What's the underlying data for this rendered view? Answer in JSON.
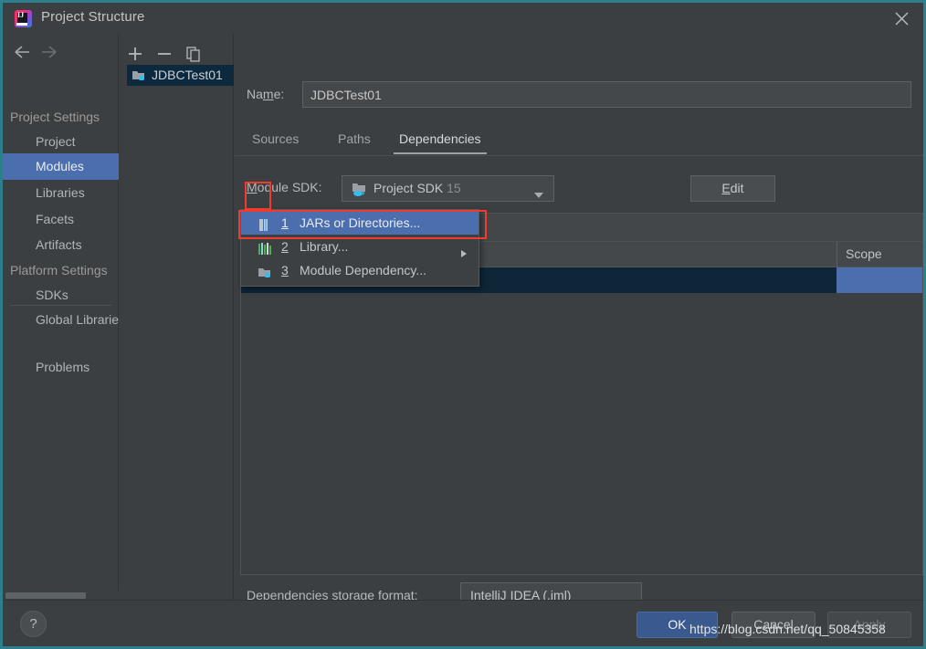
{
  "window": {
    "title": "Project Structure",
    "app_icon": "intellij-idea-logo",
    "close_icon": "close-icon",
    "border_color": "#2d7f8d",
    "background": "#3c3f41"
  },
  "nav": {
    "back_icon": "arrow-left-icon",
    "forward_icon": "arrow-right-icon"
  },
  "sidebar": {
    "groups": [
      {
        "label": "Project Settings",
        "type": "group"
      },
      {
        "label": "Project",
        "type": "child",
        "selected": false
      },
      {
        "label": "Modules",
        "type": "child",
        "selected": true
      },
      {
        "label": "Libraries",
        "type": "child",
        "selected": false
      },
      {
        "label": "Facets",
        "type": "child",
        "selected": false
      },
      {
        "label": "Artifacts",
        "type": "child",
        "selected": false
      },
      {
        "label": "Platform Settings",
        "type": "group"
      },
      {
        "label": "SDKs",
        "type": "child",
        "selected": false
      },
      {
        "label": "Global Libraries",
        "type": "child",
        "selected": false
      },
      {
        "label": "Problems",
        "type": "child",
        "selected": false
      }
    ],
    "selected_index": 2
  },
  "module_panel": {
    "toolbar": [
      {
        "name": "add-module-button",
        "icon": "plus-icon"
      },
      {
        "name": "remove-module-button",
        "icon": "minus-icon"
      },
      {
        "name": "copy-module-button",
        "icon": "copy-icon"
      }
    ],
    "modules": [
      {
        "label": "JDBCTest01",
        "icon": "module-folder-icon",
        "selected": true
      }
    ]
  },
  "main": {
    "name_label": "Name:",
    "name_label_mnemonic": "m",
    "name_value": "JDBCTest01",
    "tabs": [
      {
        "label": "Sources",
        "active": false
      },
      {
        "label": "Paths",
        "active": false
      },
      {
        "label": "Dependencies",
        "active": true
      }
    ],
    "sdk_label": "Module SDK:",
    "sdk_label_mnemonic": "M",
    "sdk_value": "Project SDK",
    "sdk_version": "15",
    "sdk_icon": "sdk-folder-java-icon",
    "sdk_dropdown_icon": "chevron-down-icon",
    "edit_button": "Edit",
    "edit_button_mnemonic": "E",
    "dep_toolbar": [
      {
        "name": "add-dependency-button",
        "icon": "plus-icon",
        "enabled": true
      },
      {
        "name": "remove-dependency-button",
        "icon": "minus-icon",
        "enabled": false
      },
      {
        "name": "move-up-button",
        "icon": "triangle-up-icon",
        "enabled": false
      },
      {
        "name": "move-down-button",
        "icon": "triangle-down-icon",
        "enabled": true
      },
      {
        "name": "edit-dependency-button",
        "icon": "pencil-icon",
        "enabled": false
      }
    ],
    "table": {
      "columns": [
        "",
        "Scope"
      ],
      "scope_header": "Scope",
      "rows": [
        {
          "name": "",
          "scope": "",
          "selected": true
        }
      ]
    },
    "storage_format_label": "Dependencies storage format:",
    "storage_format_value": "IntelliJ IDEA (.iml)",
    "storage_dropdown_icon": "chevron-down-icon"
  },
  "popup_menu": {
    "items": [
      {
        "number": "1",
        "label": "JARs or Directories...",
        "icon": "jar-file-icon",
        "highlighted": true,
        "has_submenu": false
      },
      {
        "number": "2",
        "label": "Library...",
        "icon": "library-icon",
        "highlighted": false,
        "has_submenu": true
      },
      {
        "number": "3",
        "label": "Module Dependency...",
        "icon": "module-folder-icon",
        "highlighted": false,
        "has_submenu": false
      }
    ]
  },
  "annotations": [
    {
      "name": "plus-button-highlight",
      "color": "#f03c2e"
    },
    {
      "name": "jars-or-directories-highlight",
      "color": "#f03c2e"
    }
  ],
  "footer": {
    "help_label": "?",
    "ok_label": "OK",
    "cancel_label": "Cancel",
    "apply_label": "Apply",
    "apply_enabled": false
  },
  "watermark": "https://blog.csdn.net/qq_50845358"
}
